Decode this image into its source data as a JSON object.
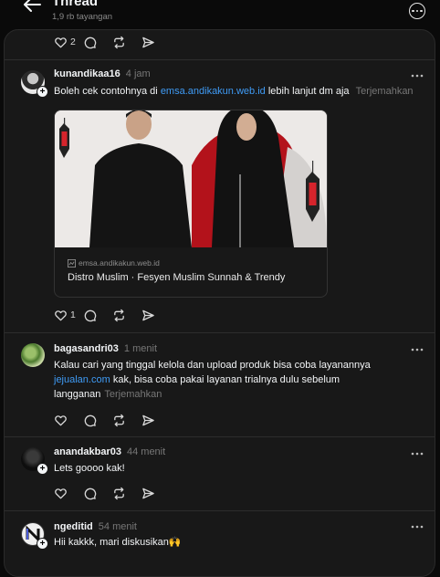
{
  "header": {
    "title": "Thread",
    "views": "1,9 rb tayangan"
  },
  "colors": {
    "background": "#0a0a0a",
    "panel": "#181818",
    "link": "#3f9bf5",
    "muted": "#777777"
  },
  "top_actions": {
    "like_count": "2"
  },
  "posts": [
    {
      "username": "kunandikaa16",
      "time": "4 jam",
      "text_before": "Boleh cek contohnya di",
      "link": "emsa.andikakun.web.id",
      "text_after": "lebih lanjut dm aja",
      "translate": "Terjemahkan",
      "card": {
        "domain": "emsa.andikakun.web.id",
        "title": "Distro Muslim · Fesyen Muslim Sunnah & Trendy"
      },
      "like_count": "1"
    },
    {
      "username": "bagasandri03",
      "time": "1 menit",
      "text_line1": "Kalau cari yang tinggal kelola dan upload produk bisa coba layanannya",
      "link": "jejualan.com",
      "text_line2": "kak, bisa coba pakai layanan trialnya dulu sebelum",
      "text_line3": "langganan",
      "translate": "Terjemahkan"
    },
    {
      "username": "anandakbar03",
      "time": "44 menit",
      "text": "Lets goooo kak!"
    },
    {
      "username": "ngeditid",
      "time": "54 menit",
      "text": "Hii kakkk, mari diskusikan🙌"
    }
  ],
  "icons": [
    "back-arrow-icon",
    "more-circle-icon",
    "heart-icon",
    "comment-icon",
    "repost-icon",
    "share-icon",
    "more-dots-icon",
    "plus-icon",
    "link-icon"
  ]
}
